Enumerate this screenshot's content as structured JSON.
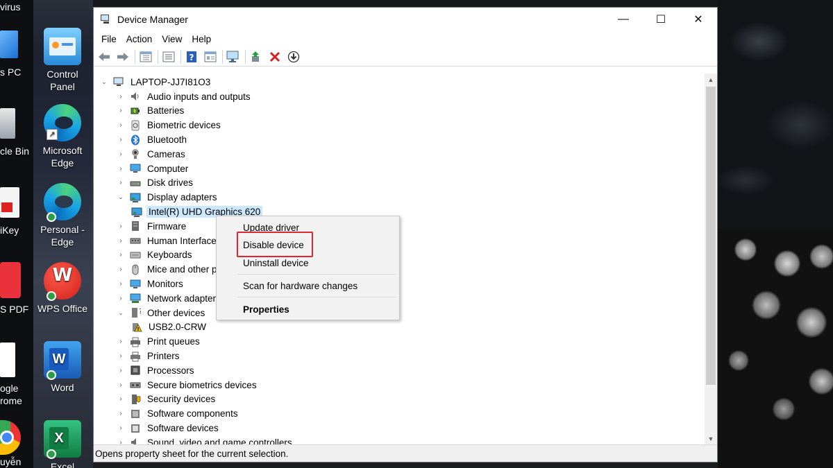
{
  "desktop": {
    "icons": [
      {
        "label": "Control Panel"
      },
      {
        "label": "Microsoft Edge"
      },
      {
        "label": "Personal - Edge"
      },
      {
        "label": "WPS Office"
      },
      {
        "label": "Word"
      },
      {
        "label": "Excel"
      }
    ],
    "cut_labels": [
      "virus",
      "s PC",
      "cle Bin",
      "iKey",
      "S PDF",
      "ogle",
      "rome",
      "uyễn"
    ]
  },
  "window": {
    "title": "Device Manager",
    "controls": {
      "minimize": "—",
      "maximize": "☐",
      "close": "✕"
    }
  },
  "menubar": {
    "items": [
      "File",
      "Action",
      "View",
      "Help"
    ]
  },
  "toolbar": {
    "icons": [
      "back-arrow-icon",
      "forward-arrow-icon",
      "properties-grid-icon",
      "list-icon",
      "help-icon",
      "details-icon",
      "monitor-scan-icon",
      "update-driver-icon",
      "uninstall-x-icon",
      "download-circle-icon"
    ]
  },
  "tree": {
    "root": "LAPTOP-JJ7I81O3",
    "categories": [
      {
        "label": "Audio inputs and outputs",
        "icon": "speaker-icon",
        "expanded": false
      },
      {
        "label": "Batteries",
        "icon": "battery-icon",
        "expanded": false
      },
      {
        "label": "Biometric devices",
        "icon": "fingerprint-icon",
        "expanded": false
      },
      {
        "label": "Bluetooth",
        "icon": "bluetooth-icon",
        "expanded": false
      },
      {
        "label": "Cameras",
        "icon": "camera-icon",
        "expanded": false
      },
      {
        "label": "Computer",
        "icon": "computer-icon",
        "expanded": false
      },
      {
        "label": "Disk drives",
        "icon": "disk-icon",
        "expanded": false
      },
      {
        "label": "Display adapters",
        "icon": "display-adapter-icon",
        "expanded": true,
        "children": [
          "Intel(R) UHD Graphics 620"
        ]
      },
      {
        "label": "Firmware",
        "icon": "firmware-icon",
        "expanded": false
      },
      {
        "label": "Human Interface",
        "icon": "hid-icon",
        "expanded": false
      },
      {
        "label": "Keyboards",
        "icon": "keyboard-icon",
        "expanded": false
      },
      {
        "label": "Mice and other p",
        "icon": "mouse-icon",
        "expanded": false
      },
      {
        "label": "Monitors",
        "icon": "monitor-icon",
        "expanded": false
      },
      {
        "label": "Network adapters",
        "icon": "network-icon",
        "expanded": false
      },
      {
        "label": "Other devices",
        "icon": "other-devices-icon",
        "expanded": true,
        "children": [
          "USB2.0-CRW"
        ]
      },
      {
        "label": "Print queues",
        "icon": "print-queue-icon",
        "expanded": false
      },
      {
        "label": "Printers",
        "icon": "printer-icon",
        "expanded": false
      },
      {
        "label": "Processors",
        "icon": "processor-icon",
        "expanded": false
      },
      {
        "label": "Secure biometrics devices",
        "icon": "secure-biometric-icon",
        "expanded": false
      },
      {
        "label": "Security devices",
        "icon": "security-icon",
        "expanded": false
      },
      {
        "label": "Software components",
        "icon": "software-component-icon",
        "expanded": false
      },
      {
        "label": "Software devices",
        "icon": "software-device-icon",
        "expanded": false
      },
      {
        "label": "Sound, video and game controllers",
        "icon": "sound-icon",
        "expanded": false
      }
    ],
    "selected": "Intel(R) UHD Graphics 620"
  },
  "context_menu": {
    "items": [
      {
        "label": "Update driver"
      },
      {
        "label": "Disable device",
        "highlighted": true
      },
      {
        "label": "Uninstall device"
      },
      {
        "label": "Scan for hardware changes"
      },
      {
        "label": "Properties",
        "bold": true
      }
    ],
    "highlight_color": "#e0262c"
  },
  "statusbar": {
    "text": "Opens property sheet for the current selection."
  },
  "colors": {
    "selection": "#cce8ff",
    "menu_bg": "#f2f2f2"
  }
}
